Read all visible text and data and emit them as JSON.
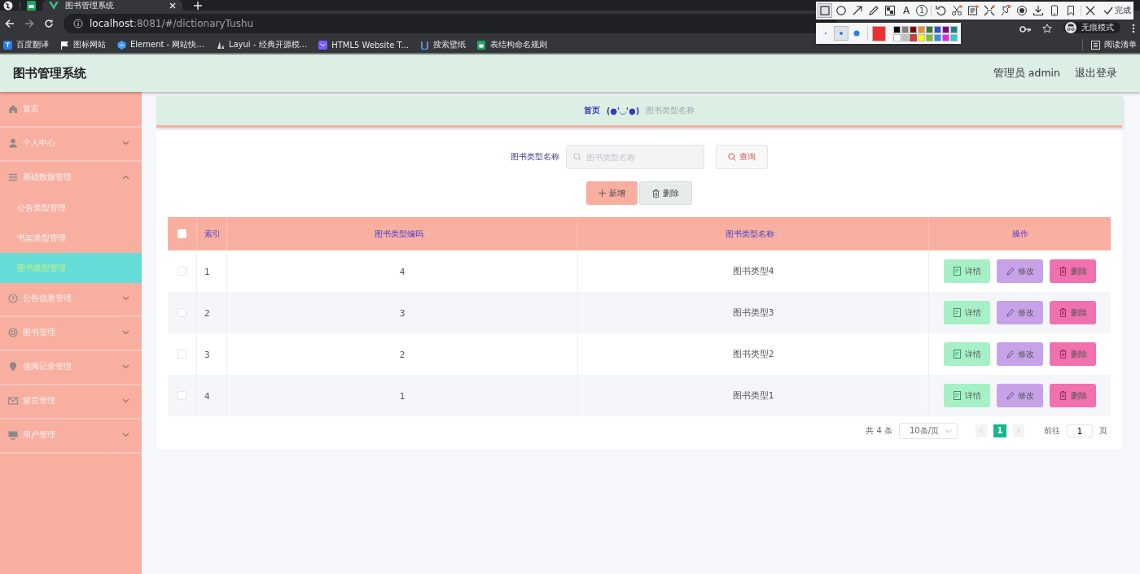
{
  "browser": {
    "tabs": [
      {
        "title": "图书管理系统",
        "selected": true
      }
    ],
    "url_host": "localhost",
    "url_rest": ":8081/#/dictionaryTushu",
    "bookmarks": [
      {
        "label": "百度翻译",
        "kind": "translate"
      },
      {
        "label": "图标网站",
        "kind": "flag"
      },
      {
        "label": "Element - 网站快...",
        "kind": "hex"
      },
      {
        "label": "Layui - 经典开源模...",
        "kind": "layui"
      },
      {
        "label": "HTML5 Website T...",
        "kind": "chat"
      },
      {
        "label": "搜索壁纸",
        "kind": "u"
      },
      {
        "label": "表结构命名规则",
        "kind": "sheet"
      }
    ],
    "incognito": "无痕模式",
    "reading_list": "阅读清单"
  },
  "capture_toolbar": {
    "tools": [
      {
        "kind": "rect",
        "selected": true
      },
      {
        "kind": "circle",
        "selected": false
      },
      {
        "kind": "arrow",
        "selected": false
      },
      {
        "kind": "pencil",
        "selected": false
      },
      {
        "kind": "mosaic",
        "selected": false
      },
      {
        "kind": "text",
        "glyph": "A",
        "selected": false
      },
      {
        "kind": "number",
        "glyph": "1",
        "selected": false
      },
      {
        "kind": "sep"
      },
      {
        "kind": "undo"
      },
      {
        "kind": "scissors"
      },
      {
        "kind": "ocr"
      },
      {
        "kind": "expand"
      },
      {
        "kind": "pin"
      },
      {
        "kind": "record"
      },
      {
        "kind": "download"
      },
      {
        "kind": "phone"
      },
      {
        "kind": "bookmark"
      },
      {
        "kind": "sep"
      },
      {
        "kind": "close"
      }
    ],
    "done": "完成",
    "sizes": [
      {
        "selected": false
      },
      {
        "selected": true
      },
      {
        "selected": false
      }
    ],
    "palette": [
      {
        "color": "#000000",
        "selected": false
      },
      {
        "color": "#808080",
        "selected": false
      },
      {
        "color": "#800000",
        "selected": false
      },
      {
        "color": "#f08a30",
        "selected": false
      },
      {
        "color": "#30803a",
        "selected": false
      },
      {
        "color": "#3050d0",
        "selected": false
      },
      {
        "color": "#800080",
        "selected": false
      },
      {
        "color": "#108888",
        "selected": false
      },
      {
        "color": "#ffffff",
        "selected": false
      },
      {
        "color": "#c0c0c0",
        "selected": false
      },
      {
        "color": "#f03030",
        "selected": true
      },
      {
        "color": "#ffff00",
        "selected": false
      },
      {
        "color": "#80c020",
        "selected": false
      },
      {
        "color": "#3090f0",
        "selected": false
      },
      {
        "color": "#f020f0",
        "selected": false
      },
      {
        "color": "#20d0d0",
        "selected": false
      }
    ]
  },
  "app": {
    "title": "图书管理系统",
    "user": "管理员 admin",
    "logout": "退出登录"
  },
  "sidebar": {
    "items": [
      {
        "label": "首页",
        "kind": "home"
      },
      {
        "label": "个人中心",
        "kind": "user",
        "expanded": false
      },
      {
        "label": "基础数据管理",
        "kind": "list",
        "expanded": true,
        "children": [
          {
            "label": "公告类型管理",
            "selected": false
          },
          {
            "label": "书架类型管理",
            "selected": false
          },
          {
            "label": "图书类型管理",
            "selected": true
          }
        ]
      },
      {
        "label": "公告信息管理",
        "kind": "clock",
        "expanded": false
      },
      {
        "label": "图书管理",
        "kind": "ring",
        "expanded": false
      },
      {
        "label": "借阅记录管理",
        "kind": "pin",
        "expanded": false
      },
      {
        "label": "留言管理",
        "kind": "mail",
        "expanded": false
      },
      {
        "label": "用户管理",
        "kind": "monitor",
        "expanded": false
      }
    ]
  },
  "breadcrumb": [
    {
      "label": "首页",
      "current": false
    },
    {
      "label": "(●'◡'●)",
      "current": false
    },
    {
      "label": "图书类型名称",
      "current": true
    }
  ],
  "search": {
    "label": "图书类型名称",
    "placeholder": "图书类型名称",
    "button": "查询"
  },
  "actions": [
    {
      "kind": "add",
      "label": "新增"
    },
    {
      "kind": "delete",
      "label": "删除"
    }
  ],
  "table": {
    "select_all_checked": false,
    "columns": [
      {
        "label": "索引",
        "sortable": false
      },
      {
        "label": "图书类型编码",
        "sortable": true
      },
      {
        "label": "图书类型名称",
        "sortable": true
      },
      {
        "label": "操作",
        "sortable": false
      }
    ],
    "rows": [
      {
        "checked": false,
        "cells": [
          "1",
          "4",
          "图书类型4"
        ],
        "buttons": [
          {
            "kind": "detail",
            "label": "详情"
          },
          {
            "kind": "edit",
            "label": "修改"
          },
          {
            "kind": "remove",
            "label": "删除"
          }
        ]
      },
      {
        "checked": false,
        "cells": [
          "2",
          "3",
          "图书类型3"
        ],
        "buttons": [
          {
            "kind": "detail",
            "label": "详情"
          },
          {
            "kind": "edit",
            "label": "修改"
          },
          {
            "kind": "remove",
            "label": "删除"
          }
        ]
      },
      {
        "checked": false,
        "cells": [
          "3",
          "2",
          "图书类型2"
        ],
        "buttons": [
          {
            "kind": "detail",
            "label": "详情"
          },
          {
            "kind": "edit",
            "label": "修改"
          },
          {
            "kind": "remove",
            "label": "删除"
          }
        ]
      },
      {
        "checked": false,
        "cells": [
          "4",
          "1",
          "图书类型1"
        ],
        "buttons": [
          {
            "kind": "detail",
            "label": "详情"
          },
          {
            "kind": "edit",
            "label": "修改"
          },
          {
            "kind": "remove",
            "label": "删除"
          }
        ]
      }
    ]
  },
  "pagination": {
    "total": "共 4 条",
    "page_size": "10条/页",
    "pages": [
      {
        "label": "1",
        "selected": true
      }
    ],
    "goto": "前往",
    "goto_value": "1",
    "page_unit": "页"
  }
}
